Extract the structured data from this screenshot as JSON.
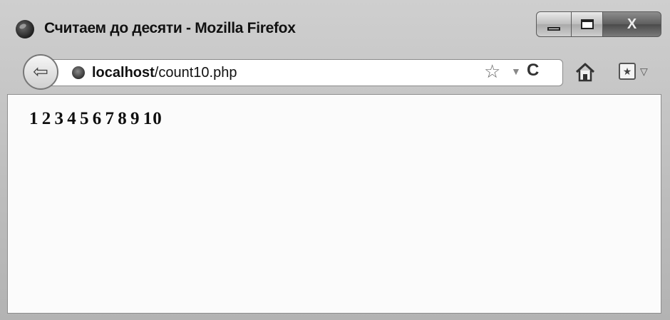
{
  "window": {
    "title": "Считаем до десяти - Mozilla Firefox",
    "controls": {
      "minimize": "minimize",
      "maximize": "maximize",
      "close": "X"
    }
  },
  "navbar": {
    "url_host": "localhost",
    "url_path": "/count10.php",
    "icons": [
      "back-arrow-icon",
      "globe-icon",
      "star-icon",
      "dropdown-icon",
      "reload-icon",
      "home-icon",
      "bookmark-icon"
    ]
  },
  "content": {
    "text": "1 2 3 4 5 6 7 8 9 10"
  },
  "colors": {
    "chrome": "#c4c4c4",
    "content_bg": "#fbfbfb",
    "text": "#0f0f0f"
  }
}
